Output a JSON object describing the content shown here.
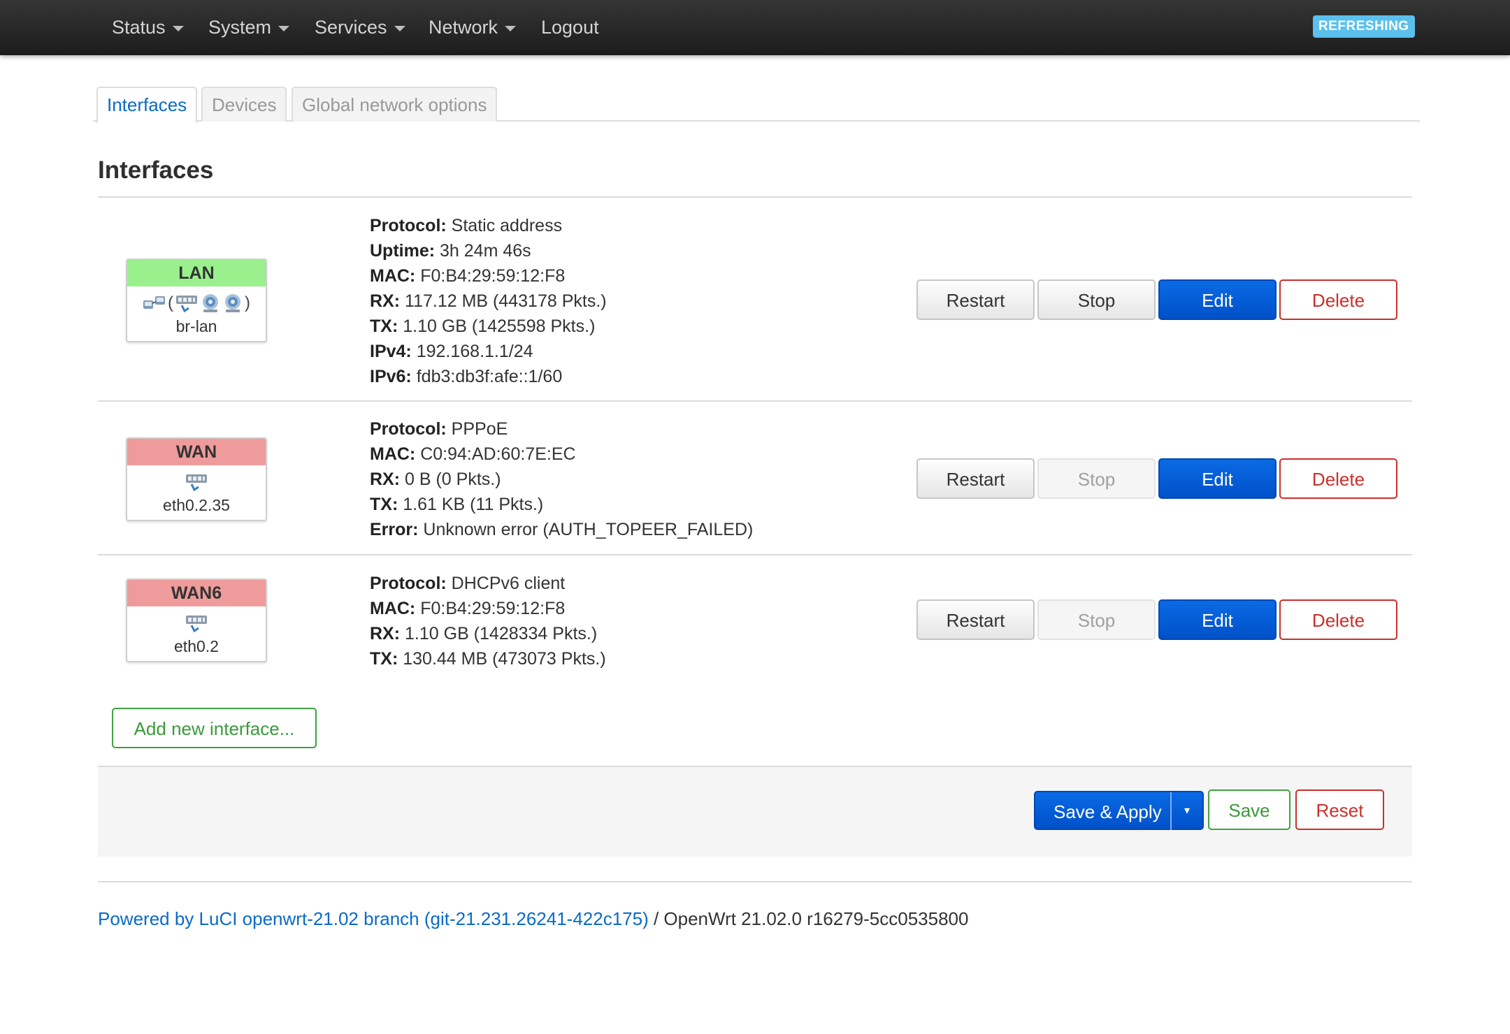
{
  "nav": {
    "menus": [
      {
        "label": "Status",
        "has_caret": true
      },
      {
        "label": "System",
        "has_caret": true
      },
      {
        "label": "Services",
        "has_caret": true
      },
      {
        "label": "Network",
        "has_caret": true
      }
    ],
    "logout": "Logout",
    "badge": "REFRESHING"
  },
  "tabs": [
    "Interfaces",
    "Devices",
    "Global network options"
  ],
  "page_title": "Interfaces",
  "interfaces": [
    {
      "name": "LAN",
      "color": "#99f08c",
      "device": "br-lan",
      "icons": [
        "bridge-icon",
        "ethernet-port-icon",
        "wifi-icon",
        "wifi-icon"
      ],
      "details": [
        {
          "key": "Protocol:",
          "value": "Static address"
        },
        {
          "key": "Uptime:",
          "value": "3h 24m 46s"
        },
        {
          "key": "MAC:",
          "value": "F0:B4:29:59:12:F8"
        },
        {
          "key": "RX:",
          "value": "117.12 MB (443178 Pkts.)"
        },
        {
          "key": "TX:",
          "value": "1.10 GB (1425598 Pkts.)"
        },
        {
          "key": "IPv4:",
          "value": "192.168.1.1/24"
        },
        {
          "key": "IPv6:",
          "value": "fdb3:db3f:afe::1/60"
        }
      ],
      "buttons": {
        "restart": "Restart",
        "stop": "Stop",
        "edit": "Edit",
        "delete": "Delete"
      },
      "stop_enabled": true
    },
    {
      "name": "WAN",
      "color": "#ef9b9b",
      "device": "eth0.2.35",
      "icons": [
        "ethernet-port-icon"
      ],
      "details": [
        {
          "key": "Protocol:",
          "value": "PPPoE"
        },
        {
          "key": "MAC:",
          "value": "C0:94:AD:60:7E:EC"
        },
        {
          "key": "RX:",
          "value": "0 B (0 Pkts.)"
        },
        {
          "key": "TX:",
          "value": "1.61 KB (11 Pkts.)"
        },
        {
          "key": "Error:",
          "value": "Unknown error (AUTH_TOPEER_FAILED)"
        }
      ],
      "buttons": {
        "restart": "Restart",
        "stop": "Stop",
        "edit": "Edit",
        "delete": "Delete"
      },
      "stop_enabled": false
    },
    {
      "name": "WAN6",
      "color": "#ef9b9b",
      "device": "eth0.2",
      "icons": [
        "ethernet-port-icon"
      ],
      "details": [
        {
          "key": "Protocol:",
          "value": "DHCPv6 client"
        },
        {
          "key": "MAC:",
          "value": "F0:B4:29:59:12:F8"
        },
        {
          "key": "RX:",
          "value": "1.10 GB (1428334 Pkts.)"
        },
        {
          "key": "TX:",
          "value": "130.44 MB (473073 Pkts.)"
        }
      ],
      "buttons": {
        "restart": "Restart",
        "stop": "Stop",
        "edit": "Edit",
        "delete": "Delete"
      },
      "stop_enabled": false
    }
  ],
  "add_interface": "Add new interface...",
  "actions": {
    "save_apply": "Save & Apply",
    "save": "Save",
    "reset": "Reset",
    "caret": "▾"
  },
  "footer": {
    "link": "Powered by LuCI openwrt-21.02 branch (git-21.231.26241-422c175)",
    "sep": " / ",
    "version": "OpenWrt 21.02.0 r16279-5cc0535800"
  }
}
